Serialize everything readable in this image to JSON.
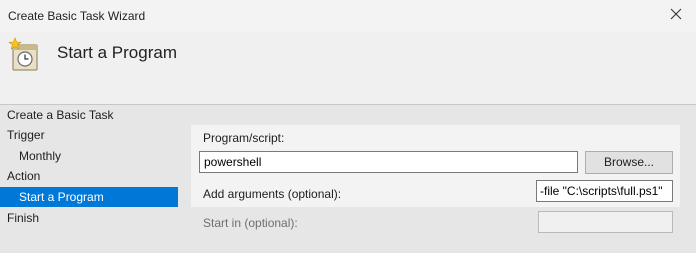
{
  "window": {
    "title": "Create Basic Task Wizard"
  },
  "header": {
    "title": "Start a Program",
    "icon": "task-clock-icon"
  },
  "nav": {
    "items": [
      {
        "label": "Create a Basic Task"
      },
      {
        "label": "Trigger"
      },
      {
        "label": "Monthly"
      },
      {
        "label": "Action"
      },
      {
        "label": "Start a Program"
      },
      {
        "label": "Finish"
      }
    ],
    "selected_color": "#0078d7"
  },
  "form": {
    "program_label": "Program/script:",
    "program_value": "powershell",
    "browse_label": "Browse...",
    "args_label": "Add arguments (optional):",
    "args_value": "-file \"C:\\scripts\\full.ps1\"",
    "startin_label": "Start in (optional):",
    "startin_value": ""
  }
}
